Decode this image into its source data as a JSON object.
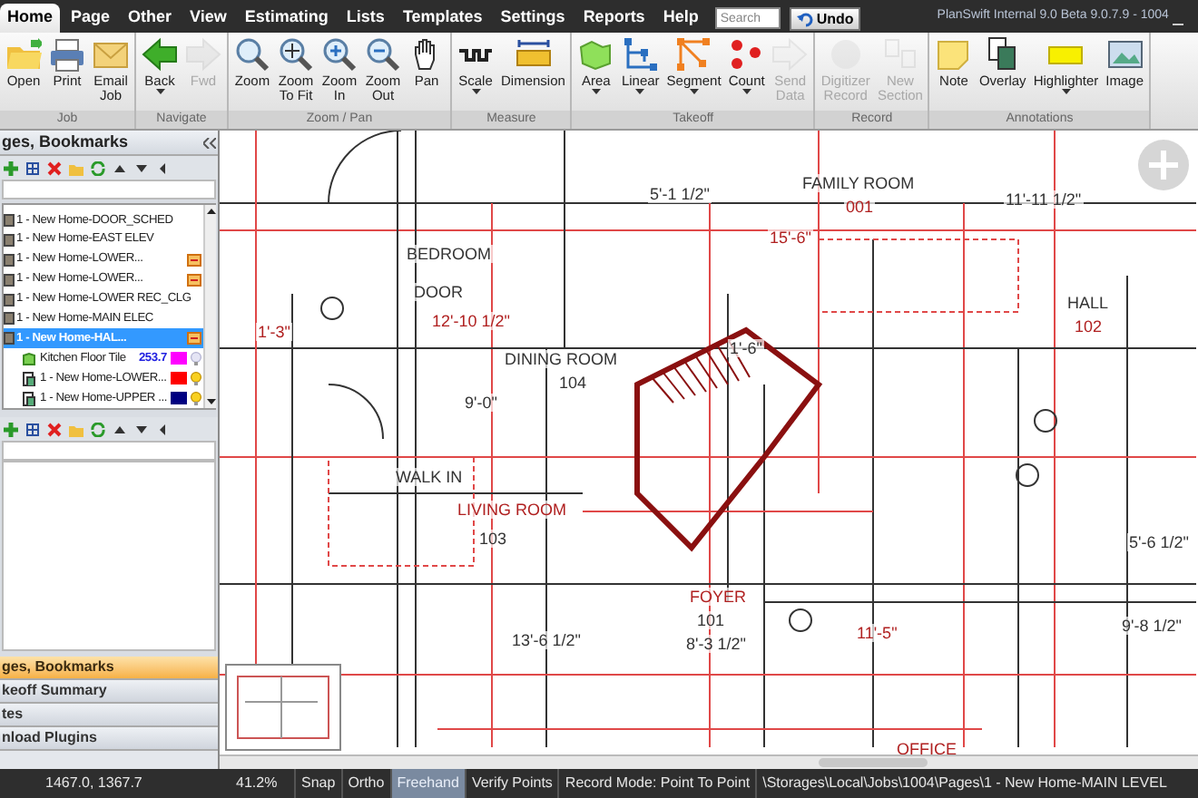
{
  "menu": [
    {
      "label": "Home",
      "selected": true
    },
    {
      "label": "Page",
      "selected": false
    },
    {
      "label": "Other",
      "selected": false
    },
    {
      "label": "View",
      "selected": false
    },
    {
      "label": "Estimating",
      "selected": false
    },
    {
      "label": "Lists",
      "selected": false
    },
    {
      "label": "Templates",
      "selected": false
    },
    {
      "label": "Settings",
      "selected": false
    },
    {
      "label": "Reports",
      "selected": false
    },
    {
      "label": "Help",
      "selected": false
    }
  ],
  "search": {
    "placeholder": "Search"
  },
  "undo": {
    "label": "Undo"
  },
  "window": {
    "title": "PlanSwift Internal 9.0 Beta 9.0.7.9 - 1004"
  },
  "ribbon": [
    {
      "label": "Job",
      "buttons": [
        {
          "label": "Open",
          "disabled": false,
          "dropdown": false
        },
        {
          "label": "Print",
          "disabled": false,
          "dropdown": false
        },
        {
          "label": "Email\nJob",
          "disabled": false,
          "dropdown": false
        }
      ]
    },
    {
      "label": "Navigate",
      "buttons": [
        {
          "label": "Back",
          "disabled": false,
          "dropdown": true
        },
        {
          "label": "Fwd",
          "disabled": true,
          "dropdown": false
        }
      ]
    },
    {
      "label": "Zoom / Pan",
      "buttons": [
        {
          "label": "Zoom",
          "disabled": false,
          "dropdown": false
        },
        {
          "label": "Zoom\nTo Fit",
          "disabled": false,
          "dropdown": false
        },
        {
          "label": "Zoom\nIn",
          "disabled": false,
          "dropdown": false
        },
        {
          "label": "Zoom\nOut",
          "disabled": false,
          "dropdown": false
        },
        {
          "label": "Pan",
          "disabled": false,
          "dropdown": false
        }
      ]
    },
    {
      "label": "Measure",
      "buttons": [
        {
          "label": "Scale",
          "disabled": false,
          "dropdown": true
        },
        {
          "label": "Dimension",
          "disabled": false,
          "dropdown": false
        }
      ]
    },
    {
      "label": "Takeoff",
      "buttons": [
        {
          "label": "Area",
          "disabled": false,
          "dropdown": true
        },
        {
          "label": "Linear",
          "disabled": false,
          "dropdown": true
        },
        {
          "label": "Segment",
          "disabled": false,
          "dropdown": true
        },
        {
          "label": "Count",
          "disabled": false,
          "dropdown": true
        },
        {
          "label": "Send\nData",
          "disabled": true,
          "dropdown": false
        }
      ]
    },
    {
      "label": "Record",
      "buttons": [
        {
          "label": "Digitizer\nRecord",
          "disabled": true,
          "dropdown": false
        },
        {
          "label": "New\nSection",
          "disabled": true,
          "dropdown": false
        }
      ]
    },
    {
      "label": "Annotations",
      "buttons": [
        {
          "label": "Note",
          "disabled": false,
          "dropdown": false
        },
        {
          "label": "Overlay",
          "disabled": false,
          "dropdown": false
        },
        {
          "label": "Highlighter",
          "disabled": false,
          "dropdown": true
        },
        {
          "label": "Image",
          "disabled": false,
          "dropdown": false
        }
      ]
    }
  ],
  "panel": {
    "title": "ges, Bookmarks",
    "tree": [
      {
        "label": "1 - New Home-DOOR_SCHED",
        "selected": false,
        "scaled": false
      },
      {
        "label": "1 - New Home-EAST ELEV",
        "selected": false,
        "scaled": false
      },
      {
        "label": "1 - New Home-LOWER...",
        "selected": false,
        "scaled": true
      },
      {
        "label": "1 - New Home-LOWER...",
        "selected": false,
        "scaled": true
      },
      {
        "label": "1 - New Home-LOWER REC_CLG",
        "selected": false,
        "scaled": false
      },
      {
        "label": "1 - New Home-MAIN ELEC",
        "selected": false,
        "scaled": false
      },
      {
        "label": "1 - New Home-HAL...",
        "selected": true,
        "scaled": true,
        "children": [
          {
            "label": "Kitchen Floor Tile",
            "value": "253.7",
            "color": "#ff00ff",
            "visible": false
          },
          {
            "label": "1 - New Home-LOWER...",
            "color": "#ff0000",
            "visible": true
          },
          {
            "label": "1 - New Home-UPPER ...",
            "color": "#000080",
            "visible": true
          }
        ]
      }
    ]
  },
  "accordion": [
    {
      "label": "ges, Bookmarks",
      "selected": true
    },
    {
      "label": "keoff Summary",
      "selected": false
    },
    {
      "label": "tes",
      "selected": false
    },
    {
      "label": "nload Plugins",
      "selected": false
    }
  ],
  "plan_labels": [
    "FAMILY ROOM",
    "001",
    "5'-1 1/2\"",
    "11'-11 1/2\"",
    "15'-6\"",
    "BEDROOM",
    "DOOR",
    "12'-10 1/2\"",
    "DINING ROOM",
    "104",
    "1'-3\"",
    "1'-6\"",
    "HALL",
    "102",
    "9'-0\"",
    "WALK IN",
    "LIVING ROOM",
    "103",
    "5'-6 1/2\"",
    "FOYER",
    "101",
    "8'-3 1/2\"",
    "11'-5\"",
    "13'-6 1/2\"",
    "9'-8 1/2\"",
    "OFFICE"
  ],
  "status": {
    "coords": "1467.0, 1367.7",
    "zoom": "41.2%",
    "toggles": [
      {
        "label": "Snap",
        "on": false
      },
      {
        "label": "Ortho",
        "on": false
      },
      {
        "label": "Freehand",
        "on": true
      },
      {
        "label": "Verify Points",
        "on": false
      }
    ],
    "record_mode": "Record Mode: Point To Point",
    "path": "\\Storages\\Local\\Jobs\\1004\\Pages\\1 - New Home-MAIN LEVEL"
  }
}
